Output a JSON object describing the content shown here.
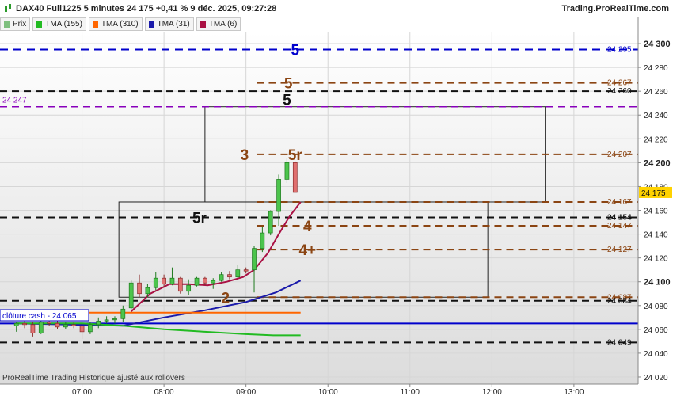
{
  "header": {
    "title": "DAX40 Full1225 5 minutes 24 175 +0,41 % 9 déc. 2025, 09:27:28",
    "brand": "Trading.ProRealTime.com"
  },
  "legend": [
    {
      "label": "Prix",
      "color": "#7fbf7f"
    },
    {
      "label": "TMA (155)",
      "color": "#22bb22"
    },
    {
      "label": "TMA (310)",
      "color": "#ff6600"
    },
    {
      "label": "TMA (31)",
      "color": "#1a1aaa"
    },
    {
      "label": "TMA (6)",
      "color": "#aa1144"
    }
  ],
  "footer": "ProRealTime Trading  Historique ajusté aux rollovers",
  "close_cash_label": "clôture cash -  24 065",
  "chart_data": {
    "type": "line",
    "ylim": [
      24014,
      24310
    ],
    "y_ticks": [
      24020,
      24040,
      24060,
      24080,
      24100,
      24120,
      24140,
      24160,
      24180,
      24200,
      24220,
      24240,
      24260,
      24280,
      24300
    ],
    "y_ticks_bold": [
      24100,
      24200,
      24300
    ],
    "x_ticks": [
      {
        "label": "07:00",
        "t": 420
      },
      {
        "label": "08:00",
        "t": 480
      },
      {
        "label": "09:00",
        "t": 540
      },
      {
        "label": "10:00",
        "t": 600
      },
      {
        "label": "11:00",
        "t": 660
      },
      {
        "label": "12:00",
        "t": 720
      },
      {
        "label": "13:00",
        "t": 780
      }
    ],
    "current_price": {
      "value": 24175,
      "label": "24 175"
    },
    "levels": [
      {
        "value": 24295,
        "label": "24 295",
        "color": "#0000cc",
        "dash": "10,7",
        "width": 2
      },
      {
        "value": 24267,
        "label": "24 267",
        "color": "#8b4513",
        "dash": "9,6",
        "width": 2
      },
      {
        "value": 24260,
        "label": "24 260",
        "color": "#111111",
        "dash": "9,6",
        "width": 2
      },
      {
        "value": 24247,
        "label": "24 247",
        "color": "#8800bb",
        "dash": "9,6",
        "width": 1.5
      },
      {
        "value": 24207,
        "label": "24 207",
        "color": "#8b4513",
        "dash": "9,6",
        "width": 2
      },
      {
        "value": 24167,
        "label": "24 167",
        "color": "#8b4513",
        "dash": "9,6",
        "width": 2
      },
      {
        "value": 24154,
        "label": "24 154",
        "color": "#111111",
        "dash": "9,6",
        "width": 2
      },
      {
        "value": 24147,
        "label": "24 147",
        "color": "#8b4513",
        "dash": "9,6",
        "width": 2
      },
      {
        "value": 24127,
        "label": "24 127",
        "color": "#8b4513",
        "dash": "9,6",
        "width": 2
      },
      {
        "value": 24087,
        "label": "24 087",
        "color": "#8b4513",
        "dash": "9,6",
        "width": 2
      },
      {
        "value": 24084,
        "label": "24 084",
        "color": "#111111",
        "dash": "9,6",
        "width": 2
      },
      {
        "value": 24065,
        "label": "",
        "color": "#0000cc",
        "dash": "",
        "width": 2
      },
      {
        "value": 24049,
        "label": "24 049",
        "color": "#111111",
        "dash": "9,6",
        "width": 2
      }
    ],
    "level_markers": [
      {
        "text": "5",
        "value": 24295,
        "t": 576,
        "color": "#0000cc"
      },
      {
        "text": "5",
        "value": 24267,
        "t": 571,
        "color": "#8b4513"
      },
      {
        "text": "5",
        "value": 24253,
        "t": 570,
        "color": "#111111"
      },
      {
        "text": "3",
        "value": 24207,
        "t": 539,
        "color": "#8b4513"
      },
      {
        "text": "5r",
        "value": 24207,
        "t": 576,
        "color": "#8b4513"
      },
      {
        "text": "5r",
        "value": 24154,
        "t": 506,
        "color": "#111111"
      },
      {
        "text": "4",
        "value": 24147,
        "t": 585,
        "color": "#8b4513"
      },
      {
        "text": "4+",
        "value": 24127,
        "t": 585,
        "color": "#8b4513"
      },
      {
        "text": "2",
        "value": 24087,
        "t": 525,
        "color": "#8b4513"
      }
    ],
    "boxes": [
      {
        "t1": 510,
        "t2": 759,
        "top": 24247,
        "bottom": 24167
      },
      {
        "t1": 447,
        "t2": 717,
        "top": 24167,
        "bottom": 24087
      }
    ],
    "candles": [
      {
        "t": 372,
        "o": 24063,
        "h": 24066,
        "l": 24058,
        "c": 24065
      },
      {
        "t": 378,
        "o": 24065,
        "h": 24068,
        "l": 24061,
        "c": 24064
      },
      {
        "t": 384,
        "o": 24064,
        "h": 24066,
        "l": 24054,
        "c": 24057
      },
      {
        "t": 390,
        "o": 24057,
        "h": 24067,
        "l": 24056,
        "c": 24066
      },
      {
        "t": 396,
        "o": 24066,
        "h": 24068,
        "l": 24063,
        "c": 24065
      },
      {
        "t": 402,
        "o": 24065,
        "h": 24067,
        "l": 24060,
        "c": 24062
      },
      {
        "t": 408,
        "o": 24062,
        "h": 24066,
        "l": 24060,
        "c": 24064
      },
      {
        "t": 414,
        "o": 24064,
        "h": 24066,
        "l": 24061,
        "c": 24063
      },
      {
        "t": 420,
        "o": 24063,
        "h": 24065,
        "l": 24052,
        "c": 24058
      },
      {
        "t": 426,
        "o": 24058,
        "h": 24066,
        "l": 24056,
        "c": 24064
      },
      {
        "t": 432,
        "o": 24064,
        "h": 24070,
        "l": 24061,
        "c": 24067
      },
      {
        "t": 438,
        "o": 24067,
        "h": 24071,
        "l": 24065,
        "c": 24068
      },
      {
        "t": 444,
        "o": 24068,
        "h": 24071,
        "l": 24065,
        "c": 24069
      },
      {
        "t": 450,
        "o": 24069,
        "h": 24080,
        "l": 24066,
        "c": 24077
      },
      {
        "t": 456,
        "o": 24078,
        "h": 24101,
        "l": 24076,
        "c": 24099
      },
      {
        "t": 462,
        "o": 24099,
        "h": 24106,
        "l": 24087,
        "c": 24090
      },
      {
        "t": 468,
        "o": 24090,
        "h": 24098,
        "l": 24087,
        "c": 24095
      },
      {
        "t": 474,
        "o": 24095,
        "h": 24108,
        "l": 24093,
        "c": 24103
      },
      {
        "t": 480,
        "o": 24103,
        "h": 24106,
        "l": 24095,
        "c": 24098
      },
      {
        "t": 486,
        "o": 24098,
        "h": 24112,
        "l": 24097,
        "c": 24103
      },
      {
        "t": 492,
        "o": 24103,
        "h": 24104,
        "l": 24090,
        "c": 24092
      },
      {
        "t": 498,
        "o": 24092,
        "h": 24102,
        "l": 24089,
        "c": 24097
      },
      {
        "t": 504,
        "o": 24097,
        "h": 24104,
        "l": 24096,
        "c": 24103
      },
      {
        "t": 510,
        "o": 24103,
        "h": 24104,
        "l": 24097,
        "c": 24099
      },
      {
        "t": 516,
        "o": 24099,
        "h": 24103,
        "l": 24094,
        "c": 24101
      },
      {
        "t": 522,
        "o": 24101,
        "h": 24108,
        "l": 24100,
        "c": 24106
      },
      {
        "t": 528,
        "o": 24106,
        "h": 24109,
        "l": 24102,
        "c": 24104
      },
      {
        "t": 534,
        "o": 24104,
        "h": 24114,
        "l": 24103,
        "c": 24110
      },
      {
        "t": 540,
        "o": 24110,
        "h": 24112,
        "l": 24107,
        "c": 24109
      },
      {
        "t": 546,
        "o": 24110,
        "h": 24130,
        "l": 24091,
        "c": 24128
      },
      {
        "t": 552,
        "o": 24128,
        "h": 24146,
        "l": 24125,
        "c": 24141
      },
      {
        "t": 558,
        "o": 24141,
        "h": 24160,
        "l": 24139,
        "c": 24159
      },
      {
        "t": 564,
        "o": 24159,
        "h": 24190,
        "l": 24147,
        "c": 24186
      },
      {
        "t": 570,
        "o": 24186,
        "h": 24204,
        "l": 24183,
        "c": 24200
      },
      {
        "t": 576,
        "o": 24200,
        "h": 24201,
        "l": 24175,
        "c": 24175
      }
    ],
    "series": [
      {
        "name": "TMA (6)",
        "color": "#aa1144",
        "width": 2,
        "x": [
          456,
          470,
          484,
          498,
          512,
          526,
          538,
          546,
          556,
          564,
          572,
          580
        ],
        "y": [
          24075,
          24090,
          24098,
          24098,
          24097,
          24100,
          24104,
          24110,
          24124,
          24140,
          24155,
          24167
        ]
      },
      {
        "name": "TMA (31)",
        "color": "#1a1aaa",
        "width": 2,
        "x": [
          372,
          410,
          450,
          480,
          510,
          540,
          562,
          580
        ],
        "y": [
          24065,
          24064,
          24063,
          24070,
          24076,
          24083,
          24091,
          24101
        ]
      },
      {
        "name": "TMA (155)",
        "color": "#22bb22",
        "width": 2,
        "x": [
          372,
          420,
          450,
          480,
          510,
          540,
          560,
          580
        ],
        "y": [
          24065,
          24065,
          24063,
          24060,
          24058,
          24056,
          24055,
          24055
        ]
      },
      {
        "name": "TMA (310)",
        "color": "#ff6600",
        "width": 2,
        "x": [
          372,
          580
        ],
        "y": [
          24074,
          24074
        ]
      }
    ]
  }
}
